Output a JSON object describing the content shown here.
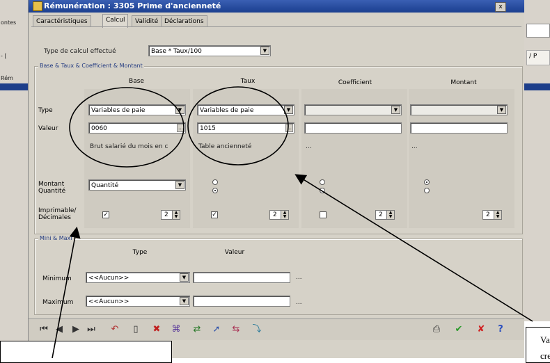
{
  "background": {
    "left_labels": [
      "ontes",
      "- [",
      "Rém"
    ],
    "right_fragment": "/ P"
  },
  "window": {
    "title": "Rémunération : 3305 Prime d'ancienneté",
    "close": "x"
  },
  "tabs": [
    {
      "label": "Caractéristiques",
      "active": false
    },
    {
      "label": "Calcul",
      "active": true
    },
    {
      "label": "Validité",
      "active": false
    },
    {
      "label": "Déclarations",
      "active": false
    }
  ],
  "calc_type": {
    "label": "Type de calcul effectué",
    "value": "Base * Taux/100"
  },
  "group_main": {
    "label": "Base & Taux & Coefficient & Montant"
  },
  "columns": [
    "Base",
    "Taux",
    "Coefficient",
    "Montant"
  ],
  "rows": {
    "type": "Type",
    "valeur": "Valeur",
    "montant_quantite": "Montant\nQuantité",
    "imprimable": "Imprimable/\nDécimales"
  },
  "base": {
    "type": "Variables de paie",
    "valeur": "0060",
    "desc": "Brut salarié du mois en c",
    "montant": "Quantité",
    "printable": true,
    "decimals": "2"
  },
  "taux": {
    "type": "Variables de paie",
    "valeur": "1015",
    "desc": "Table ancienneté",
    "printable": true,
    "decimals": "2"
  },
  "coefficient": {
    "desc": "...",
    "printable": false,
    "decimals": "2"
  },
  "montant": {
    "desc": "...",
    "decimals": "2"
  },
  "group_minmax": {
    "label": "Mini & Maxi",
    "col_type": "Type",
    "col_valeur": "Valeur"
  },
  "minimum": {
    "label": "Minimum",
    "type": "<<Aucun>>",
    "ellipsis": "..."
  },
  "maximum": {
    "label": "Maximum",
    "type": "<<Aucun>>",
    "ellipsis": "..."
  },
  "callout_right": {
    "text": "Va",
    "text2": "cre"
  },
  "accent": {
    "titlebar": "#1b3f8f",
    "dialog": "#d6d2c8",
    "ok": "#2a9a2a",
    "cancel": "#d02020",
    "help": "#2a4fbf"
  }
}
